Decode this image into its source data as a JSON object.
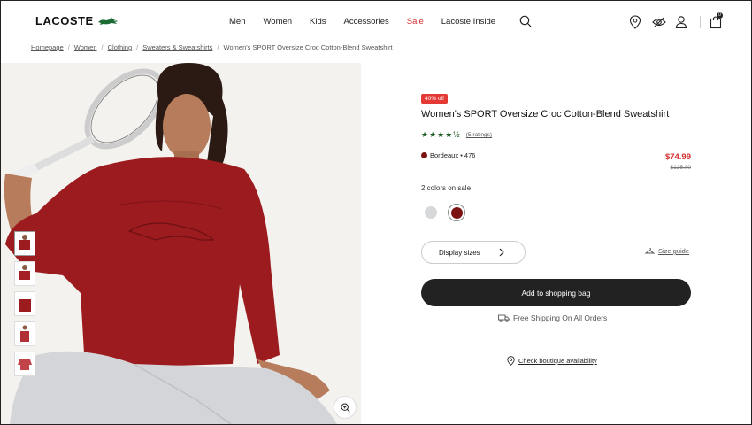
{
  "brand": {
    "name": "LACOSTE",
    "logo_icon": "crocodile-icon"
  },
  "nav": {
    "items": [
      "Men",
      "Women",
      "Kids",
      "Accessories",
      "Sale",
      "Lacoste Inside"
    ],
    "search_icon": "search-icon"
  },
  "header_icons": [
    "location-pin-icon",
    "eye-icon",
    "account-icon",
    "shopping-bag-icon"
  ],
  "cart_count": "0",
  "breadcrumb": [
    "Homepage",
    "Women",
    "Clothing",
    "Sweaters & Sweatshirts",
    "Women's SPORT Oversize Croc Cotton-Blend Sweatshirt"
  ],
  "product": {
    "badge": "40% off",
    "title": "Women's SPORT Oversize Croc Cotton-Blend Sweatshirt",
    "stars": "★★★★½",
    "rating_text": "(5 ratings)",
    "rating_value": 4.5,
    "color_name": "Bordeaux • 476",
    "price_now": "$74.99",
    "price_old": "$125.00",
    "colors_on_sale": "2 colors on sale",
    "swatches": [
      {
        "name": "Grey",
        "color": "#d7d8da"
      },
      {
        "name": "Bordeaux",
        "color": "#7b1313"
      }
    ],
    "display_sizes": "Display sizes",
    "size_guide": "Size guide",
    "add_to_bag": "Add to shopping bag",
    "shipping": "Free Shipping On All Orders",
    "boutique": "Check boutique availability"
  },
  "colors": {
    "sale_red": "#d32f2f",
    "badge_red": "#e53935",
    "button_dark": "#222222",
    "rating_green": "#1b5e20",
    "sweatshirt": "#9c1b1f"
  }
}
